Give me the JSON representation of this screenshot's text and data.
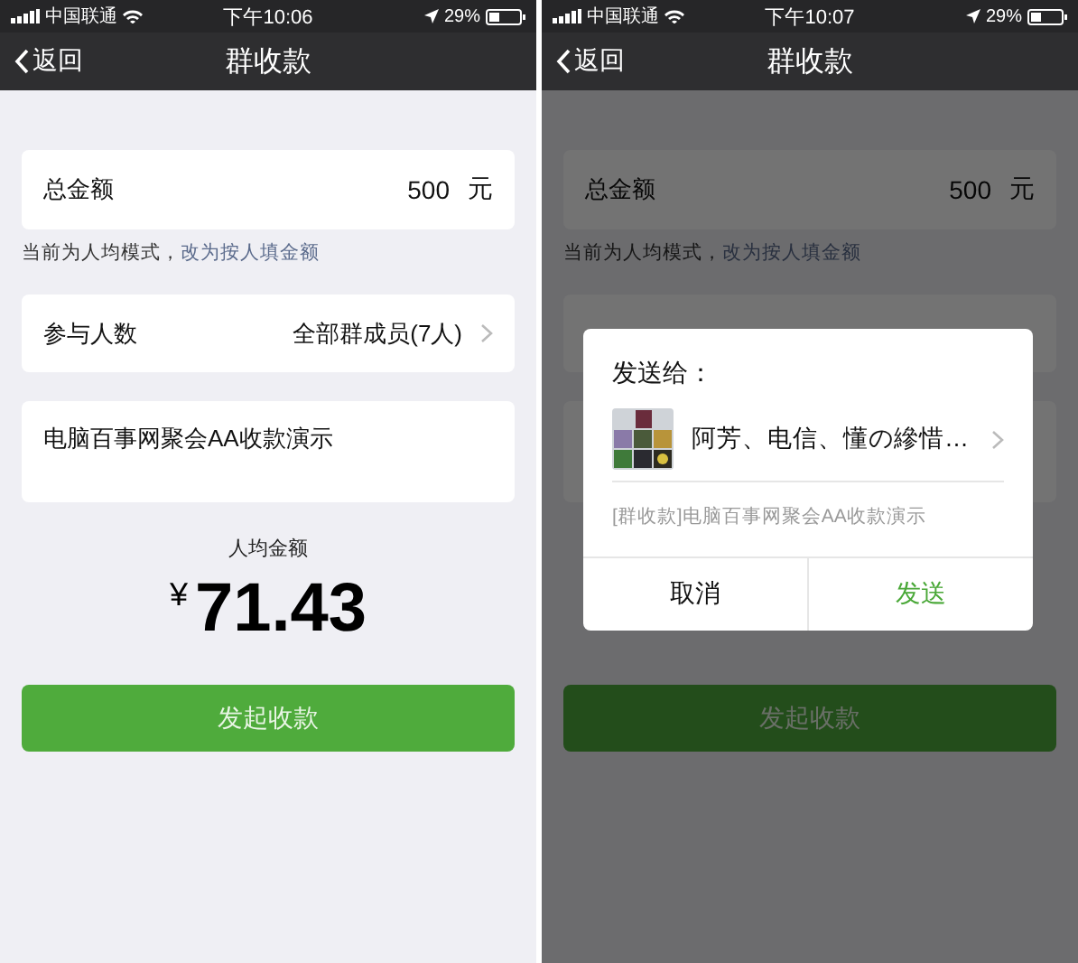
{
  "screens": [
    {
      "status_bar": {
        "carrier": "中国联通",
        "time": "下午10:06",
        "battery": "29%"
      },
      "nav": {
        "back": "返回",
        "title": "群收款"
      },
      "total": {
        "label": "总金额",
        "value": "500",
        "unit": "元"
      },
      "hint": {
        "text": "当前为人均模式，",
        "link": "改为按人填金额"
      },
      "participants": {
        "label": "参与人数",
        "value": "全部群成员(7人)"
      },
      "note": "电脑百事网聚会AA收款演示",
      "per_person": {
        "label": "人均金额",
        "currency": "¥",
        "amount": "71.43"
      },
      "submit": "发起收款",
      "dimmed": false
    },
    {
      "status_bar": {
        "carrier": "中国联通",
        "time": "下午10:07",
        "battery": "29%"
      },
      "nav": {
        "back": "返回",
        "title": "群收款"
      },
      "total": {
        "label": "总金额",
        "value": "500",
        "unit": "元"
      },
      "hint": {
        "text": "当前为人均模式，",
        "link": "改为按人填金额"
      },
      "submit": "发起收款",
      "dimmed": true,
      "dialog": {
        "title": "发送给：",
        "recipients": "阿芳、电信、懂の縿惜…",
        "message": "[群收款]电脑百事网聚会AA收款演示",
        "buttons": [
          {
            "label": "取消",
            "kind": "cancel"
          },
          {
            "label": "发送",
            "kind": "confirm"
          }
        ]
      }
    }
  ]
}
